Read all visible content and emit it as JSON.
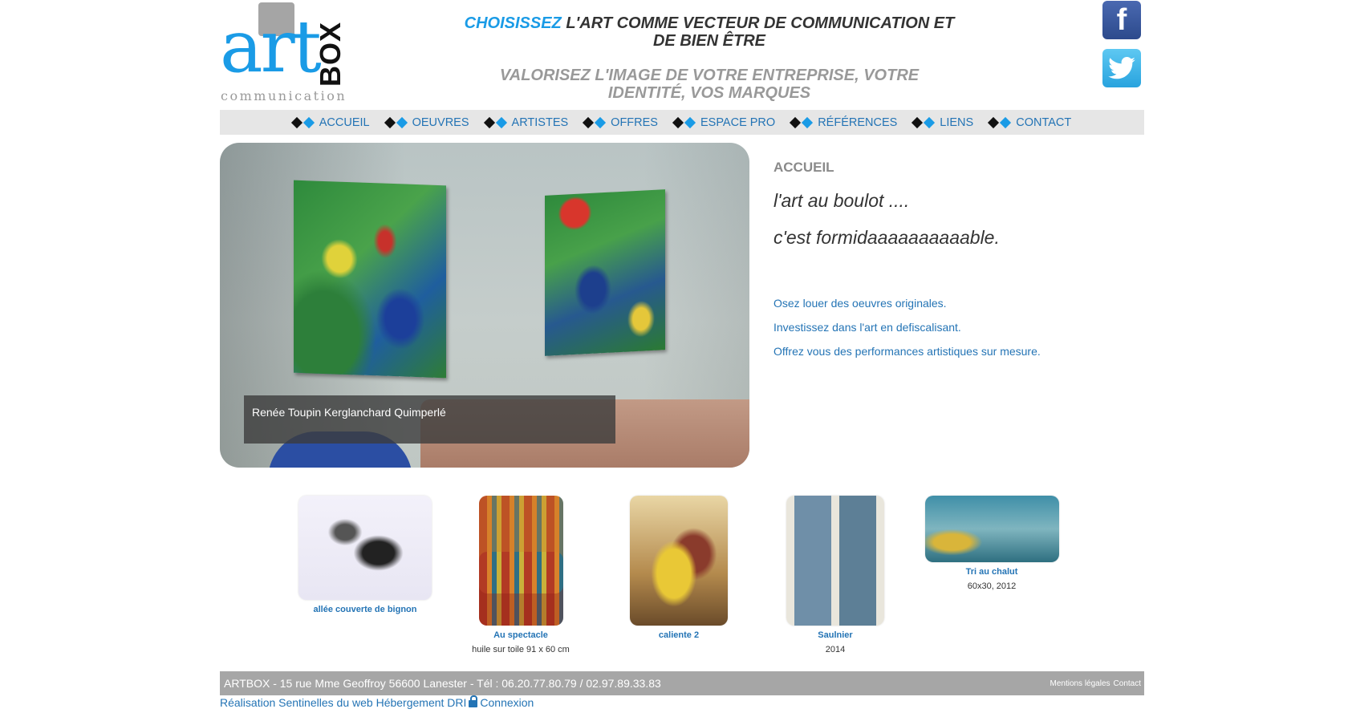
{
  "logo": {
    "art": "art",
    "box": "BOX",
    "communication": "communication"
  },
  "tagline": {
    "highlight": "CHOISISSEZ",
    "line1_rest": " L'ART COMME VECTEUR DE COMMUNICATION ET DE BIEN ÊTRE",
    "line2": "VALORISEZ L'IMAGE DE VOTRE ENTREPRISE, VOTRE IDENTITÉ, VOS MARQUES"
  },
  "social": {
    "facebook": "f"
  },
  "nav": [
    "ACCUEIL",
    "OEUVRES",
    "ARTISTES",
    "OFFRES",
    "ESPACE PRO",
    "RÉFÉRENCES",
    "LIENS",
    "CONTACT"
  ],
  "hero": {
    "caption": "Renée Toupin Kerglanchard Quimperlé"
  },
  "intro": {
    "section_title": "ACCUEIL",
    "line1": "l'art au boulot ....",
    "line2": "c'est formidaaaaaaaaaable.",
    "links": [
      "Osez louer des oeuvres originales.",
      "Investissez dans l'art en defiscalisant.",
      "Offrez vous des performances artistiques sur mesure."
    ]
  },
  "thumbnails": [
    {
      "title": "allée couverte de bignon",
      "subtitle": ""
    },
    {
      "title": "Au spectacle",
      "subtitle": "huile sur toile 91 x 60 cm"
    },
    {
      "title": "caliente 2",
      "subtitle": ""
    },
    {
      "title": "Saulnier",
      "subtitle": "2014"
    },
    {
      "title": "Tri au chalut",
      "subtitle": "60x30, 2012"
    }
  ],
  "footer": {
    "address": "ARTBOX - 15 rue Mme Geoffroy 56600 Lanester - Tél : 06.20.77.80.79 / 02.97.89.33.83",
    "legal": "Mentions légales",
    "contact": "Contact"
  },
  "credits": {
    "realisation": "Réalisation Sentinelles du web",
    "hebergement": "Hébergement DRI",
    "connexion": "Connexion"
  }
}
